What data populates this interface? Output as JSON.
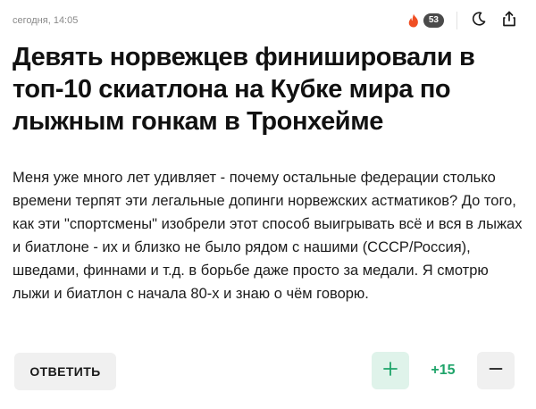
{
  "header": {
    "timestamp": "сегодня, 14:05",
    "hot_count": "53",
    "hot_icon": "fire-icon",
    "theme_icon": "moon-icon",
    "share_icon": "share-icon"
  },
  "article": {
    "title": "Девять норвежцев финишировали в топ-10 скиатлона на Кубке мира по лыжным гонкам в Тронхейме"
  },
  "comment": {
    "text": "Меня уже много лет удивляет - почему остальные федерации столько времени терпят эти легальные допинги норвежских астматиков? До того, как эти \"спортсмены\" изобрели этот способ выигрывать всё и вся в лыжах и биатлоне - их и близко не было рядом с нашими (СССР/Россия), шведами, финнами и т.д. в борьбе даже просто за медали. Я смотрю лыжи и биатлон с начала 80-х и знаю о чём говорю.",
    "reply_label": "ОТВЕТИТЬ",
    "score": "+15",
    "upvote_icon": "plus-icon",
    "downvote_icon": "minus-icon"
  },
  "colors": {
    "fire": "#f04e23",
    "badge": "#4a4a4a",
    "score": "#1fa46a",
    "upvote_bg": "#dff3ea",
    "button_bg": "#f0f0f0"
  }
}
